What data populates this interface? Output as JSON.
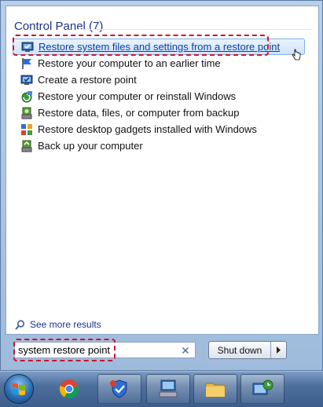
{
  "group": {
    "title": "Control Panel (7)"
  },
  "results": [
    {
      "label": "Restore system files and settings from a restore point",
      "icon": "restore-system-icon"
    },
    {
      "label": "Restore your computer to an earlier time",
      "icon": "flag-icon"
    },
    {
      "label": "Create a restore point",
      "icon": "system-properties-icon"
    },
    {
      "label": "Restore your computer or reinstall Windows",
      "icon": "recovery-icon"
    },
    {
      "label": "Restore data, files, or computer from backup",
      "icon": "backup-restore-icon"
    },
    {
      "label": "Restore desktop gadgets installed with Windows",
      "icon": "gadgets-icon"
    },
    {
      "label": "Back up your computer",
      "icon": "backup-icon"
    }
  ],
  "see_more": "See more results",
  "search": {
    "value": "system restore point"
  },
  "shutdown": {
    "label": "Shut down"
  },
  "taskbar": {
    "items": [
      "start-orb",
      "chrome-icon",
      "security-center-icon",
      "network-computer-icon",
      "file-explorer-icon",
      "system-restore-icon"
    ]
  },
  "colors": {
    "highlight": "#d2102a",
    "header": "#1e3287",
    "hover": "#cfe4fa"
  }
}
